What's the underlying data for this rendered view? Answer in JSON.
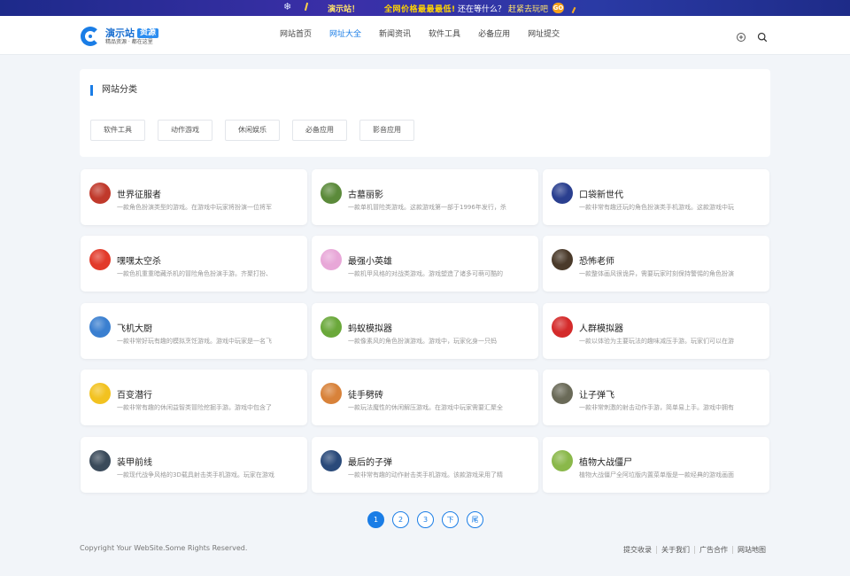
{
  "promo": {
    "text1": "演示站！",
    "text2": "全网价格最最最低!",
    "text3": "还在等什么？",
    "text4": "赶紧去玩吧",
    "go_badge": "GO"
  },
  "header": {
    "logo_name": "演示站",
    "logo_tag": "资源",
    "logo_sub": "精品资源 · 都在这里",
    "nav": [
      "网站首页",
      "网址大全",
      "新闻资讯",
      "软件工具",
      "必备应用",
      "网址提交"
    ],
    "active_nav": "网址大全",
    "icons": [
      "plus-circle-icon",
      "search-icon"
    ]
  },
  "categories": {
    "title": "网站分类",
    "items": [
      "软件工具",
      "动作游戏",
      "休闲娱乐",
      "必备应用",
      "影音应用"
    ]
  },
  "sites": [
    {
      "name": "世界征服者",
      "desc": "一款角色扮演类型的游戏。在游戏中玩家将扮演一位将军",
      "color": "#c0392b"
    },
    {
      "name": "古墓丽影",
      "desc": "一款单机冒险类游戏。这款游戏第一部于1996年发行，杀",
      "color": "#5b8a3a"
    },
    {
      "name": "口袋新世代",
      "desc": "一款非常有趣还玩的角色扮演类手机游戏。这款游戏中玩",
      "color": "#2a3f8f"
    },
    {
      "name": "嘿嘿太空杀",
      "desc": "一款色机重重暗藏杀机的冒险角色扮演手游。齐聚打扮、",
      "color": "#e23a2a"
    },
    {
      "name": "最强小英雄",
      "desc": "一款机甲风格的对战类游戏。游戏塑造了诸多可萌可酷的",
      "color": "#e8a7d8"
    },
    {
      "name": "恐怖老师",
      "desc": "一款整体画风很诡异，需要玩家时刻保持警惕的角色扮演",
      "color": "#4a3a2a"
    },
    {
      "name": "飞机大厨",
      "desc": "一款非常好玩有趣的模拟烹饪游戏。游戏中玩家是一名飞",
      "color": "#3a7fd0"
    },
    {
      "name": "蚂蚁模拟器",
      "desc": "一款像素风的角色扮演游戏。游戏中，玩家化身一只蚂",
      "color": "#6aa83a"
    },
    {
      "name": "人群模拟器",
      "desc": "一款以体验为主要玩法的趣味减压手游。玩家们可以在游",
      "color": "#d42a2a"
    },
    {
      "name": "百变潜行",
      "desc": "一款非常有趣的休闲益智类冒险挖掘手游。游戏中包含了",
      "color": "#f2c220"
    },
    {
      "name": "徒手劈砖",
      "desc": "一款玩法魔性的休闲解压游戏。在游戏中玩家需要汇聚全",
      "color": "#d8823a"
    },
    {
      "name": "让子弹飞",
      "desc": "一款非常刺激的射击动作手游，简单易上手。游戏中拥有",
      "color": "#6a6a58"
    },
    {
      "name": "装甲前线",
      "desc": "一款现代战争风格的3D载具射击类手机游戏。玩家在游戏",
      "color": "#3a4a5a"
    },
    {
      "name": "最后的子弹",
      "desc": "一款非常有趣的动作射击类手机游戏。该款游戏采用了精",
      "color": "#2a4a7a"
    },
    {
      "name": "植物大战僵尸",
      "desc": "植物大战僵尸全阿垃版内置菜单版是一款经典的游戏画面",
      "color": "#8ab84a"
    }
  ],
  "pagination": {
    "pages": [
      "1",
      "2",
      "3",
      "下",
      "尾"
    ],
    "active": "1"
  },
  "footer": {
    "copyright": "Copyright Your WebSite.Some Rights Reserved.",
    "links": [
      "提交收录",
      "关于我们",
      "广告合作",
      "网站地图"
    ]
  }
}
